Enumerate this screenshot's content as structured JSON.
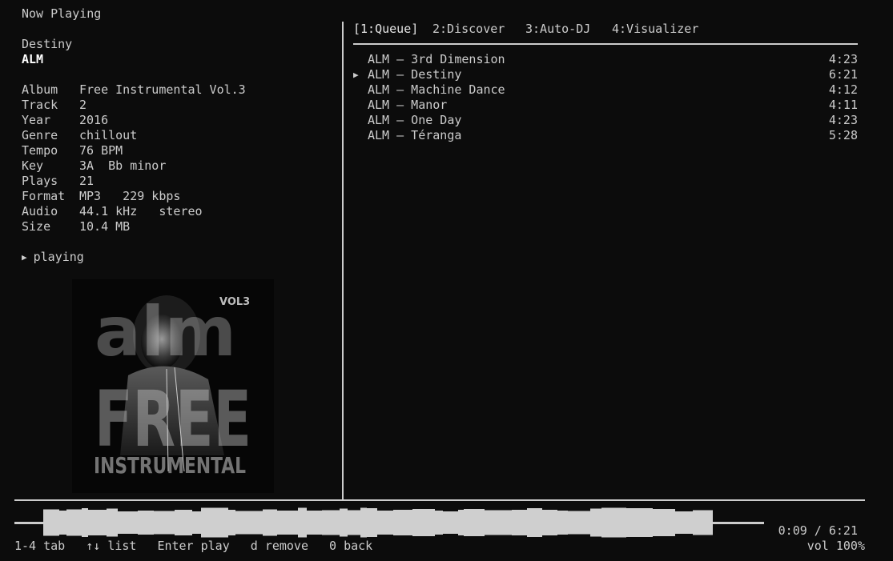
{
  "now_playing": {
    "header": "Now Playing",
    "title": "Destiny",
    "artist": "ALM",
    "metadata": [
      {
        "label": "Album",
        "value": "Free Instrumental Vol.3"
      },
      {
        "label": "Track",
        "value": "2"
      },
      {
        "label": "Year",
        "value": "2016"
      },
      {
        "label": "Genre",
        "value": "chillout"
      },
      {
        "label": "Tempo",
        "value": "76 BPM"
      },
      {
        "label": "Key",
        "value": "3A  Bb minor"
      },
      {
        "label": "Plays",
        "value": "21"
      },
      {
        "label": "Format",
        "value": "MP3   229 kbps"
      },
      {
        "label": "Audio",
        "value": "44.1 kHz   stereo"
      },
      {
        "label": "Size",
        "value": "10.4 MB"
      }
    ],
    "state_icon": "play-triangle-icon",
    "state": "playing",
    "album_art": {
      "logo_text": "alm",
      "vol_text": "VOL3",
      "word_1": "FREE",
      "word_2": "INSTRUMENTAL"
    }
  },
  "tabs": [
    {
      "label": "[1:Queue]",
      "active": true
    },
    {
      "label": "2:Discover",
      "active": false
    },
    {
      "label": "3:Auto-DJ",
      "active": false
    },
    {
      "label": "4:Visualizer",
      "active": false
    }
  ],
  "queue": [
    {
      "title": "ALM – 3rd Dimension",
      "duration": "4:23",
      "current": false
    },
    {
      "title": "ALM – Destiny",
      "duration": "6:21",
      "current": true
    },
    {
      "title": "ALM – Machine Dance",
      "duration": "4:12",
      "current": false
    },
    {
      "title": "ALM – Manor",
      "duration": "4:11",
      "current": false
    },
    {
      "title": "ALM – One Day",
      "duration": "4:23",
      "current": false
    },
    {
      "title": "ALM – Téranga",
      "duration": "5:28",
      "current": false
    }
  ],
  "queue_marker_icon": "play-triangle-icon",
  "playback": {
    "elapsed": "0:09",
    "total": "6:21",
    "time_text": "0:09 / 6:21",
    "volume_text": "vol 100%"
  },
  "hints": [
    {
      "key": "1-4",
      "action": "tab"
    },
    {
      "key": "↑↓",
      "action": "list"
    },
    {
      "key": "Enter",
      "action": "play"
    },
    {
      "key": "d",
      "action": "remove"
    },
    {
      "key": "0",
      "action": "back"
    }
  ],
  "colors": {
    "background": "#0c0c0c",
    "text": "#cccccc",
    "highlight": "#ffffff",
    "rule": "#cccccc"
  }
}
